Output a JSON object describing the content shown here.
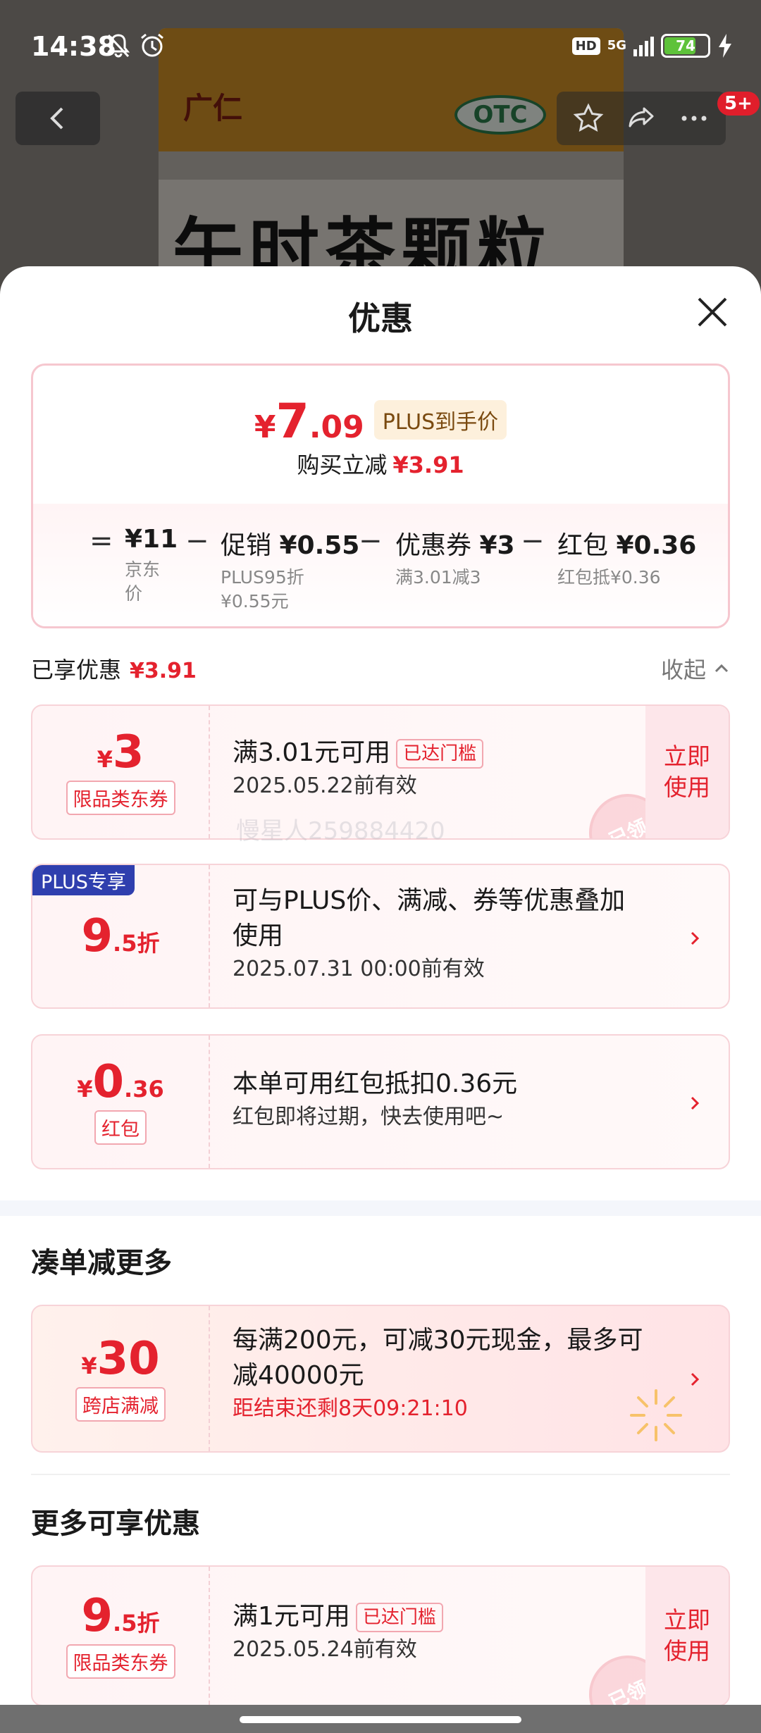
{
  "status": {
    "time": "14:38",
    "hd": "HD",
    "network": "5G",
    "battery": "74",
    "battery_level": 0.74
  },
  "background": {
    "brand": "广仁",
    "otc": "OTC",
    "product_name": "午时茶颗粒"
  },
  "nav": {
    "badge": "5+"
  },
  "sheet": {
    "title": "优惠",
    "summary": {
      "yen": "¥",
      "price_int": "7",
      "price_dec": ".09",
      "tag": "PLUS到手价",
      "save_label": "购买立减",
      "save_value": "¥3.91",
      "calc": {
        "eq": "=",
        "minus": "−",
        "base_value": "¥11",
        "base_sub": [
          "京东",
          "价"
        ],
        "promo_label": "促销",
        "promo_value": "¥0.55",
        "promo_sub": [
          "PLUS95折",
          "¥0.55元"
        ],
        "coupon_label": "优惠券",
        "coupon_value": "¥3",
        "coupon_sub": "满3.01减3",
        "redpack_label": "红包",
        "redpack_value": "¥0.36",
        "redpack_sub": "红包抵¥0.36"
      }
    },
    "enjoyed": {
      "label": "已享优惠",
      "value": "¥3.91",
      "collapse": "收起"
    },
    "coupons": [
      {
        "amt_small": "¥",
        "amt_big": "3",
        "amt_tail": "",
        "tag": "限品类东券",
        "title": "满3.01元可用",
        "badge": "已达门槛",
        "sub": "2025.05.22前有效",
        "use": "立即使用",
        "stamp": "已领"
      },
      {
        "corner": "PLUS专享",
        "amt_small": "",
        "amt_big": "9",
        "amt_tail": ".5折",
        "title_line1": "可与PLUS价、满减、券等优惠叠加",
        "title_line2": "使用",
        "sub": "2025.07.31 00:00前有效"
      },
      {
        "amt_small": "¥",
        "amt_big": "0",
        "amt_tail": ".36",
        "tag": "红包",
        "title": "本单可用红包抵扣0.36元",
        "sub": "红包即将过期，快去使用吧~"
      }
    ],
    "watermark": "慢星人259884420",
    "more_section": {
      "title": "凑单减更多",
      "card": {
        "amt_small": "¥",
        "amt_big": "30",
        "tag": "跨店满减",
        "title_line1": "每满200元，可减30元现金，最多可",
        "title_line2": "减40000元",
        "sub": "距结束还剩8天09:21:10"
      }
    },
    "extra_section": {
      "title": "更多可享优惠",
      "card": {
        "amt_big": "9",
        "amt_tail": ".5折",
        "tag": "限品类东券",
        "title": "满1元可用",
        "badge": "已达门槛",
        "sub": "2025.05.24前有效",
        "use": "立即使用",
        "stamp": "已领"
      }
    }
  },
  "colors": {
    "accent_red": "#e4222e",
    "plus_blue": "#2f3fae",
    "plus_gold_bg": "#fdf0dc"
  },
  "icons": [
    "back-icon",
    "star-icon",
    "share-icon",
    "more-icon",
    "close-icon",
    "chevron-up-icon",
    "chevron-right-icon",
    "mute-icon",
    "alarm-icon"
  ]
}
